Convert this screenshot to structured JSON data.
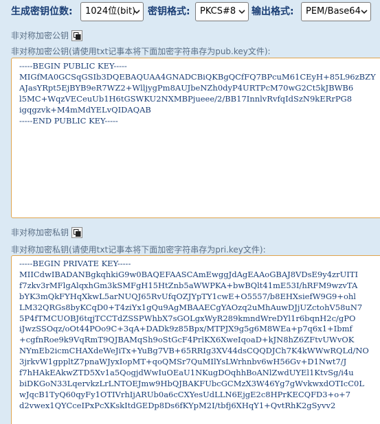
{
  "toolbar": {
    "key_length_label": "生成密钥位数:",
    "key_length_value": "1024位(bit)",
    "key_format_label": "密钥格式:",
    "key_format_value": "PKCS#8",
    "output_format_label": "输出格式:",
    "output_format_value": "PEM/Base64"
  },
  "public_key": {
    "title": "非对称加密公钥",
    "hint": "非对称加密公钥(请使用txt记事本将下面加密字符串存为pub.key文件):",
    "lines": [
      "-----BEGIN PUBLIC KEY-----",
      "MIGfMA0GCSqGSIb3DQEBAQUAA4GNADCBiQKBgQCfFQ7BPcuM61CEyH+85L96zBZY",
      "AJasYRpt5EjBYB9eR7WZ2+WlljygPm8AUJbeNZh0dyP4URTPcM70wG2Ct5kJBWB6",
      "l5MC+WqzVECeuUb1H6tGSWKU2NXMBPjueee/2/BB17InnlvRvfqIdSzN9kERrPG8",
      "igqgzvk+M4mMdYELvQIDAQAB",
      "-----END PUBLIC KEY-----"
    ]
  },
  "private_key": {
    "title": "非对称加密私钥",
    "hint": "非对称加密私钥(请使用txt记事本将下面加密字符串存为pri.key文件):",
    "lines": [
      "-----BEGIN PRIVATE KEY-----",
      "MIICdwIBADANBgkqhkiG9w0BAQEFAASCAmEwggJdAgEAAoGBAJ8VDsE9y4zrUITI",
      "f7zkv3rMFlgAlqxhGm3kSMFgH15HtZnb5aWWPKA+bwBQlt41mE53I/hRFM9wzvTA",
      "bYK3mQkFYHqXkwL5arNUQJ65RvUfqOZJYpTY1cwE+O5557/b8EHXsiefW9G9+ohl",
      "LM32QRGs8byKCqD0+T4ziYx1gQu9AgMBAAECgYAOzq2uMhAuwDJjUZctohV58uN7",
      "5P4fTMCUOBJ6tqjTCCTdZSSPWhbX7sGOLgxWyR289kmndWreDYl1r6bqnH2c/gPO",
      "iJwzSSOqz/oOt44POo9C+3qA+DADk9z85Bpx/MTPJX9g5g6M8WEa+p7q6x1+Ibmf",
      "+cgfnRoe9k9VqRmT9QJBAMqSh9oStGcF4PrlKX6XweIqoaD+kJN8hZ6ZFtvUWvOK",
      "NYmEb2icmCHAXdeWeJiTx+YuBg7VB+65RRIg3XV44dsCQQDJCh7K4kWWwRQLd/NO",
      "3jrkvW1gppltZ7pnaWJyxIopMT+qoQMSr7QuMIlYsLWrhnbv6wH56Gv+D1Nwt7/J",
      "f7hHAkEAkwZTD5Xv1a5QogjdWwIuOEaU1NKugDOqhhBoANlZwdUYEl1KtvSg/i4u",
      "biDKGoN33LqervkzLrLNTOEJmw9HbQJBAKFUbcGCMzX3W46Yg7gWvkwxdOTIcC0L",
      "wJqcB1TyQ60qyFy1OTIVrhIjARUb0a6cCXYesUdLLN6EjgE2c8HPrKECQFD3+o+7",
      "d2vwex1QYCceIPxPcXKskItdGEDp8Ds6fKYpM2I/tbfj6XHqY1+QvtRhK2gSyvv2"
    ]
  }
}
